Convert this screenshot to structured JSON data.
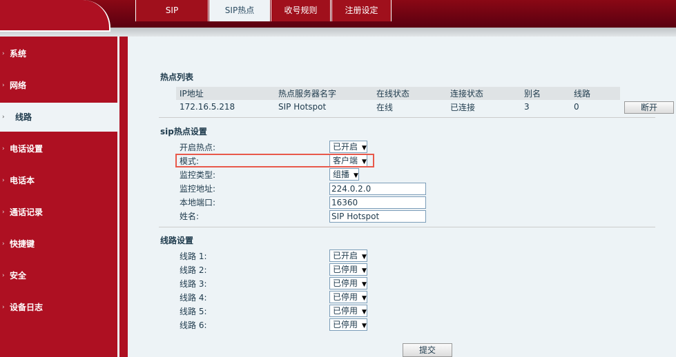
{
  "tabs": [
    "SIP",
    "SIP热点",
    "收号规则",
    "注册设定"
  ],
  "active_tab": 1,
  "sidebar": [
    "系统",
    "网络",
    "线路",
    "电话设置",
    "电话本",
    "通话记录",
    "快捷键",
    "安全",
    "设备日志"
  ],
  "active_sidebar": 2,
  "hotspot_list": {
    "title": "热点列表",
    "headers": [
      "IP地址",
      "热点服务器名字",
      "在线状态",
      "连接状态",
      "别名",
      "线路"
    ],
    "rows": [
      [
        "172.16.5.218",
        "SIP Hotspot",
        "在线",
        "已连接",
        "3",
        "0"
      ]
    ],
    "disconnect_label": "断开"
  },
  "settings": {
    "title": "sip热点设置",
    "fields": [
      {
        "label": "开启热点:",
        "type": "select",
        "value": "已开启"
      },
      {
        "label": "模式:",
        "type": "select",
        "value": "客户端"
      },
      {
        "label": "监控类型:",
        "type": "select",
        "value": "组播"
      },
      {
        "label": "监控地址:",
        "type": "input",
        "value": "224.0.2.0"
      },
      {
        "label": "本地端口:",
        "type": "input",
        "value": "16360"
      },
      {
        "label": "姓名:",
        "type": "input",
        "value": "SIP Hotspot"
      }
    ]
  },
  "lines": {
    "title": "线路设置",
    "items": [
      {
        "label": "线路 1:",
        "value": "已开启"
      },
      {
        "label": "线路 2:",
        "value": "已停用"
      },
      {
        "label": "线路 3:",
        "value": "已停用"
      },
      {
        "label": "线路 4:",
        "value": "已停用"
      },
      {
        "label": "线路 5:",
        "value": "已停用"
      },
      {
        "label": "线路 6:",
        "value": "已停用"
      }
    ]
  },
  "submit_label": "提交",
  "colors": {
    "brand_red": "#ae1022",
    "highlight": "#e8584a"
  }
}
